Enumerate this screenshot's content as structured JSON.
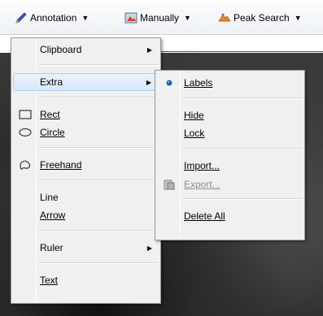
{
  "toolbar": {
    "annotation_label": "Annotation",
    "manually_label": "Manually",
    "peak_search_label": "Peak Search",
    "dropdown_arrow": "▼"
  },
  "main_menu": {
    "items": [
      {
        "label": "Clipboard",
        "has_submenu": true
      },
      {
        "label": "Extra",
        "has_submenu": true,
        "highlighted": true
      },
      {
        "label": "Rect",
        "icon": "rect-icon"
      },
      {
        "label": "Circle",
        "icon": "ellipse-icon"
      },
      {
        "label": "Freehand",
        "icon": "freehand-icon"
      },
      {
        "label": "Line"
      },
      {
        "label": "Arrow"
      },
      {
        "label": "Ruler",
        "has_submenu": true
      },
      {
        "label": "Text"
      }
    ]
  },
  "sub_menu": {
    "items": [
      {
        "label": "Labels",
        "checked": true
      },
      {
        "label": "Hide"
      },
      {
        "label": "Lock"
      },
      {
        "label": "Import..."
      },
      {
        "label": "Export...",
        "disabled": true,
        "icon": "export-icon"
      },
      {
        "label": "Delete All"
      }
    ]
  },
  "colors": {
    "menu_bg": "#f0f0f0",
    "highlight": "#d9e8f9",
    "highlight_border": "#aecff7",
    "check_dot": "#1f5fa8"
  }
}
